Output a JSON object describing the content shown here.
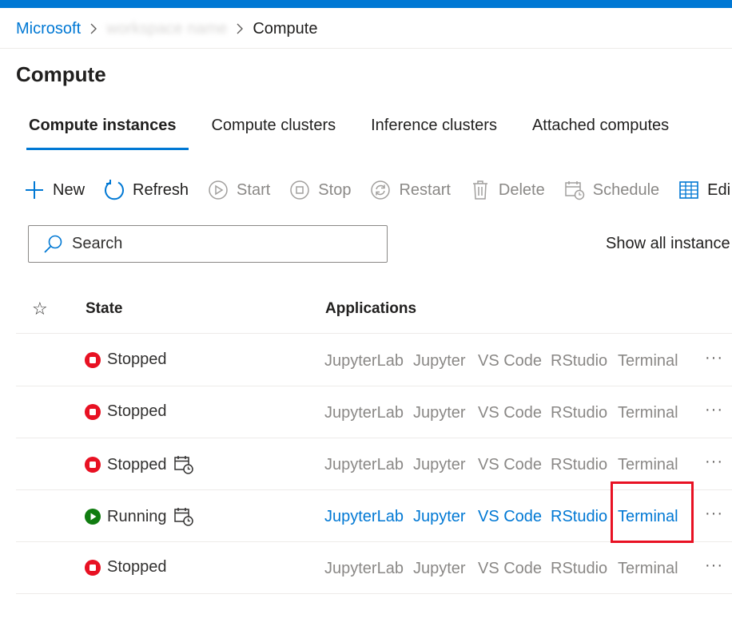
{
  "breadcrumb": {
    "root": "Microsoft",
    "middle": "workspace name",
    "current": "Compute"
  },
  "page": {
    "title": "Compute"
  },
  "tabs": [
    {
      "label": "Compute instances",
      "active": true
    },
    {
      "label": "Compute clusters",
      "active": false
    },
    {
      "label": "Inference clusters",
      "active": false
    },
    {
      "label": "Attached computes",
      "active": false
    }
  ],
  "toolbar": {
    "new": "New",
    "refresh": "Refresh",
    "start": "Start",
    "stop": "Stop",
    "restart": "Restart",
    "delete": "Delete",
    "schedule": "Schedule",
    "edit": "Edi"
  },
  "search": {
    "placeholder": "Search"
  },
  "show_all": "Show all instance",
  "grid": {
    "headers": {
      "state": "State",
      "applications": "Applications"
    },
    "apps": [
      "JupyterLab",
      "Jupyter",
      "VS Code",
      "RStudio",
      "Terminal"
    ],
    "rows": [
      {
        "state": "Stopped",
        "status": "stopped",
        "scheduled": false
      },
      {
        "state": "Stopped",
        "status": "stopped",
        "scheduled": false
      },
      {
        "state": "Stopped",
        "status": "stopped",
        "scheduled": true
      },
      {
        "state": "Running",
        "status": "running",
        "scheduled": true
      },
      {
        "state": "Stopped",
        "status": "stopped",
        "scheduled": false
      }
    ],
    "more_label": "···"
  },
  "colors": {
    "accent": "#0078d4",
    "stopped": "#e81123",
    "running": "#107c10",
    "highlight": "#e81123"
  }
}
